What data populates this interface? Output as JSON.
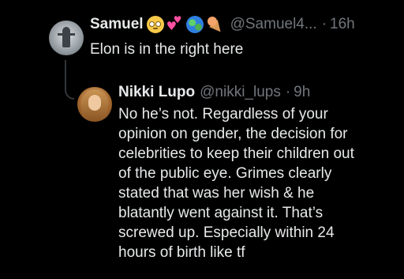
{
  "tweets": [
    {
      "author_name": "Samuel",
      "name_emojis": [
        "face-with-rolling-eyes-emoji",
        "two-hearts-emoji",
        "globe-emoji",
        "ice-cream-emoji"
      ],
      "handle": "@Samuel4...",
      "separator": "·",
      "time": "16h",
      "text": "Elon is in the right here"
    },
    {
      "author_name": "Nikki Lupo",
      "handle": "@nikki_lups",
      "separator": "·",
      "time": "9h",
      "text_lines": [
        "No he’s not. Regardless of your",
        "opinion on gender, the decision for",
        "celebrities to keep their children out",
        "of the public eye. Grimes clearly",
        "stated that was her wish & he",
        "blatantly went against it. That’s",
        "screwed up. Especially within 24",
        "hours of birth like tf"
      ]
    }
  ],
  "colors": {
    "background": "#000000",
    "primary_text": "#e7e9ea",
    "secondary_text": "#71767b",
    "thread_line": "#333639"
  }
}
